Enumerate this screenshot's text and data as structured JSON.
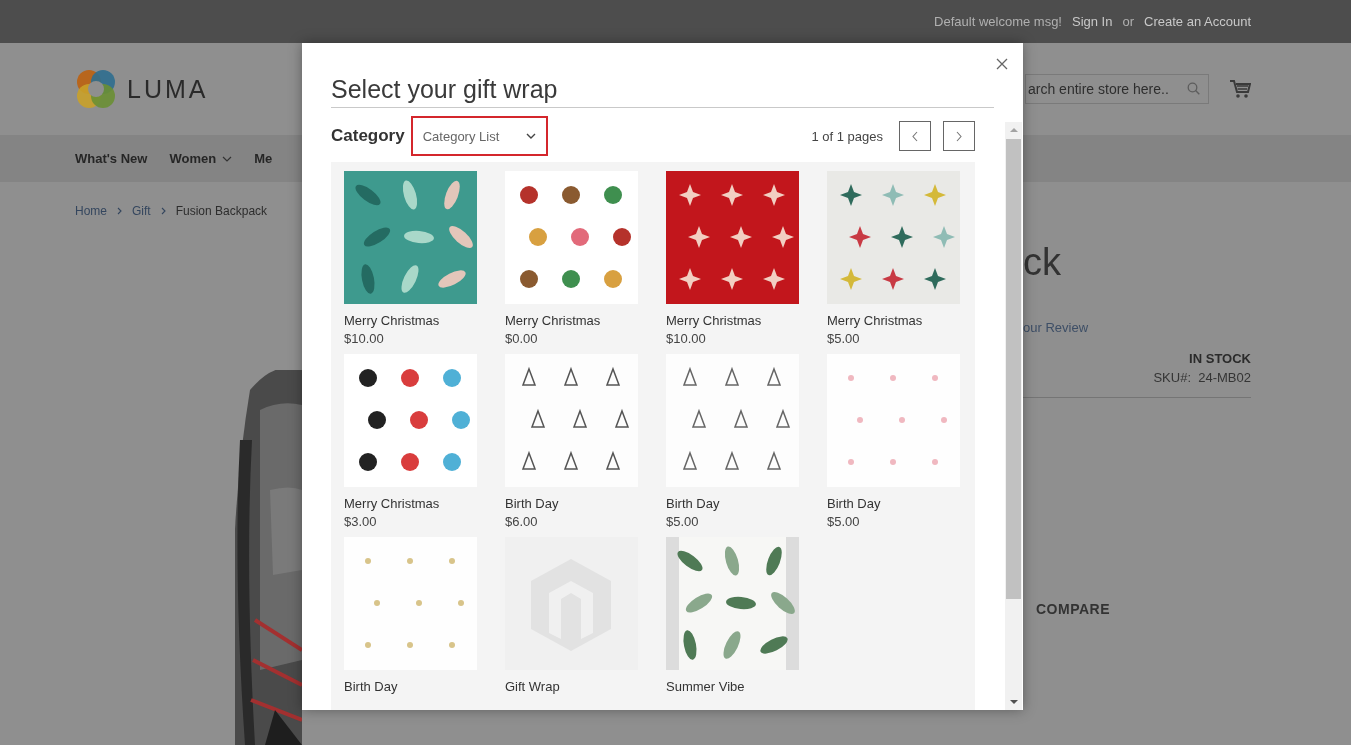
{
  "top_bar": {
    "welcome": "Default welcome msg!",
    "sign_in": "Sign In",
    "separator": "or",
    "create_account": "Create an Account"
  },
  "header": {
    "logo_text": "LUMA",
    "search": {
      "placeholder": "arch entire store here.."
    }
  },
  "nav": [
    {
      "label": "What's New",
      "has_menu": false
    },
    {
      "label": "Women",
      "has_menu": true
    },
    {
      "label": "Me",
      "has_menu": false
    }
  ],
  "breadcrumbs": [
    "Home",
    "Gift",
    "Fusion Backpack"
  ],
  "product": {
    "title": "ck",
    "review_link": "our Review",
    "stock": "IN STOCK",
    "sku_label": "SKU#:",
    "sku": "24-MB02",
    "compare": "COMPARE"
  },
  "modal": {
    "title": "Select your gift wrap",
    "category_label": "Category",
    "category_select": {
      "value": "Category List",
      "highlighted": true
    },
    "pager": "1 of 1 pages",
    "items": [
      {
        "kind": "picture",
        "name": "Merry Christmas",
        "price": "$10.00"
      },
      {
        "kind": "picture",
        "name": "Merry Christmas",
        "price": "$0.00"
      },
      {
        "kind": "picture",
        "name": "Merry Christmas",
        "price": "$10.00"
      },
      {
        "kind": "picture",
        "name": "Merry Christmas",
        "price": "$5.00"
      },
      {
        "kind": "picture",
        "name": "Merry Christmas",
        "price": "$3.00"
      },
      {
        "kind": "picture",
        "name": "Birth Day",
        "price": "$6.00"
      },
      {
        "kind": "picture",
        "name": "Birth Day",
        "price": "$5.00"
      },
      {
        "kind": "picture",
        "name": "Birth Day",
        "price": "$5.00"
      },
      {
        "kind": "picture",
        "name": "Birth Day"
      },
      {
        "kind": "placeholder",
        "name": "Gift Wrap"
      },
      {
        "kind": "picture",
        "name": "Summer Vibe"
      }
    ]
  }
}
